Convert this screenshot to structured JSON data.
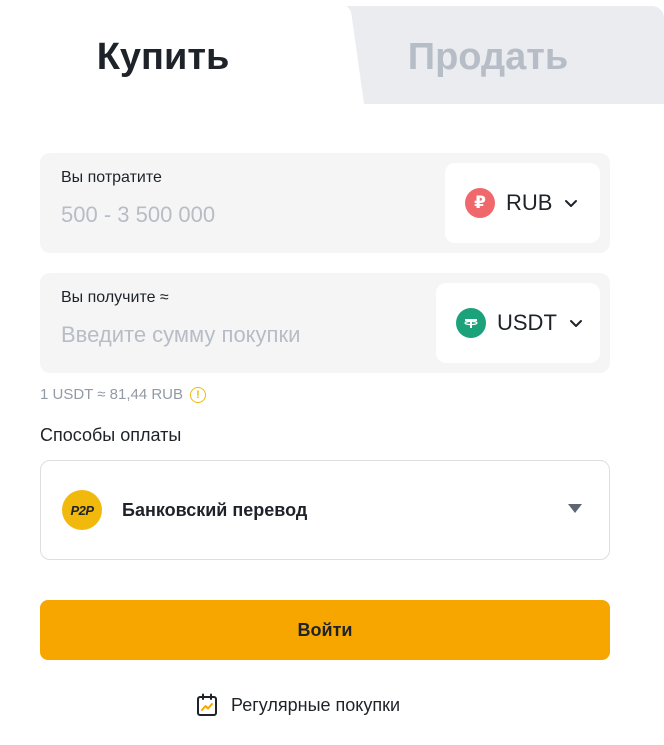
{
  "tabs": {
    "buy": "Купить",
    "sell": "Продать"
  },
  "spend": {
    "label": "Вы потратите",
    "placeholder": "500 - 3 500 000",
    "currency": "RUB",
    "currency_icon": "ruble-icon",
    "currency_color": "#f0676c"
  },
  "receive": {
    "label": "Вы получите ≈",
    "placeholder": "Введите сумму покупки",
    "currency": "USDT",
    "currency_icon": "tether-icon",
    "currency_color": "#1ba27a"
  },
  "rate": "1 USDT ≈ 81,44 RUB",
  "payment": {
    "title": "Способы оплаты",
    "selected": "Банковский перевод",
    "badge": "P2P"
  },
  "login_button": "Войти",
  "recurring_label": "Регулярные покупки",
  "colors": {
    "accent": "#f7a600",
    "muted_tab": "#b7bdc6"
  }
}
